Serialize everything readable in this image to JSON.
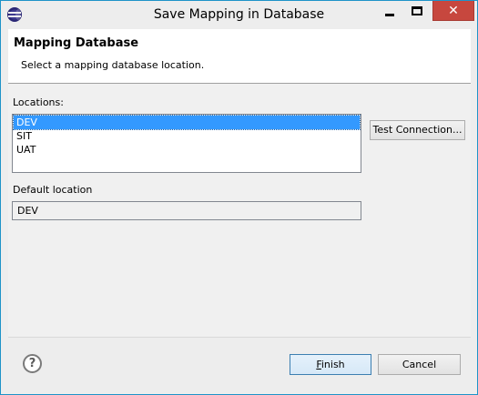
{
  "window": {
    "title": "Save Mapping in Database",
    "close_glyph": "✕"
  },
  "header": {
    "title": "Mapping Database",
    "description": "Select a mapping database location."
  },
  "locations": {
    "label": "Locations:",
    "items": [
      "DEV",
      "SIT",
      "UAT"
    ],
    "selected": "DEV"
  },
  "test_connection_label": "Test Connection...",
  "default_location": {
    "label": "Default location",
    "value": "DEV"
  },
  "footer": {
    "help_glyph": "?",
    "finish_mnemonic": "F",
    "finish_rest": "inish",
    "cancel_label": "Cancel"
  },
  "colors": {
    "selection": "#3399ff",
    "close_button": "#c7473e",
    "window_border": "#1f93c8"
  },
  "icons": {
    "app": "eclipse-icon",
    "help": "help-icon"
  }
}
